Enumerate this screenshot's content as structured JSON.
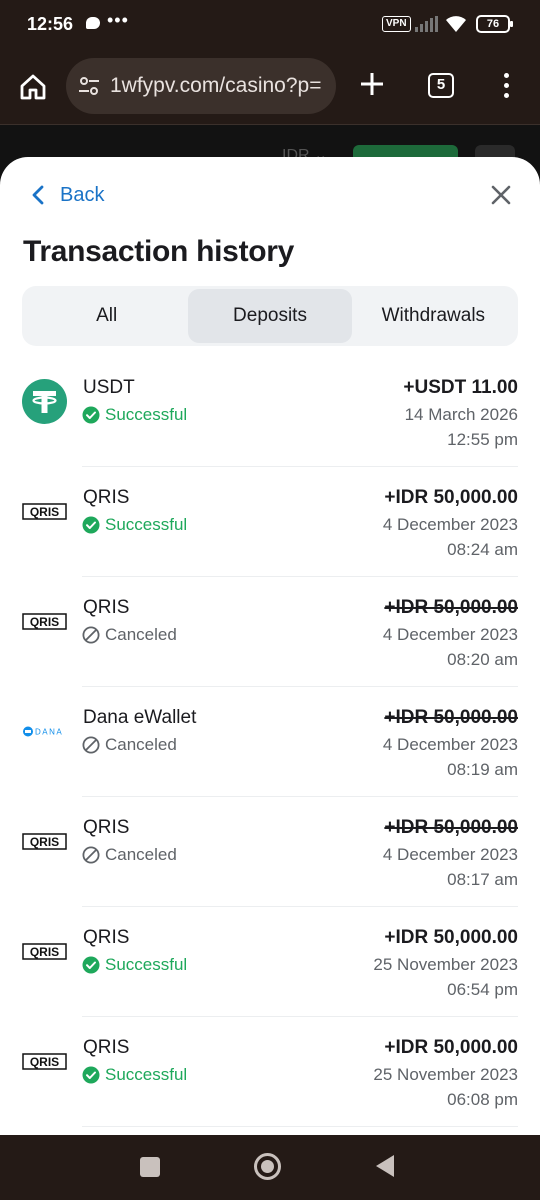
{
  "status_bar": {
    "time": "12:56",
    "dots": "•••",
    "vpn_label": "VPN",
    "battery": "76"
  },
  "browser": {
    "url": "1wfypv.com/casino?p=",
    "tab_count": "5"
  },
  "site_peek": {
    "currency": "IDR ⌄"
  },
  "sheet": {
    "back_label": "Back",
    "title": "Transaction history",
    "tabs": [
      {
        "label": "All",
        "active": false
      },
      {
        "label": "Deposits",
        "active": true
      },
      {
        "label": "Withdrawals",
        "active": false
      }
    ],
    "transactions": [
      {
        "method": "USDT",
        "logo": "tether-icon",
        "status": "Successful",
        "status_type": "ok",
        "amount": "+USDT 11.00",
        "struck": false,
        "date": "14 March 2026",
        "time": "12:55 pm"
      },
      {
        "method": "QRIS",
        "logo": "qris-icon",
        "status": "Successful",
        "status_type": "ok",
        "amount": "+IDR 50,000.00",
        "struck": false,
        "date": "4 December 2023",
        "time": "08:24 am"
      },
      {
        "method": "QRIS",
        "logo": "qris-icon",
        "status": "Canceled",
        "status_type": "cancel",
        "amount": "+IDR 50,000.00",
        "struck": true,
        "date": "4 December 2023",
        "time": "08:20 am"
      },
      {
        "method": "Dana eWallet",
        "logo": "dana-icon",
        "status": "Canceled",
        "status_type": "cancel",
        "amount": "+IDR 50,000.00",
        "struck": true,
        "date": "4 December 2023",
        "time": "08:19 am"
      },
      {
        "method": "QRIS",
        "logo": "qris-icon",
        "status": "Canceled",
        "status_type": "cancel",
        "amount": "+IDR 50,000.00",
        "struck": true,
        "date": "4 December 2023",
        "time": "08:17 am"
      },
      {
        "method": "QRIS",
        "logo": "qris-icon",
        "status": "Successful",
        "status_type": "ok",
        "amount": "+IDR 50,000.00",
        "struck": false,
        "date": "25 November 2023",
        "time": "06:54 pm"
      },
      {
        "method": "QRIS",
        "logo": "qris-icon",
        "status": "Successful",
        "status_type": "ok",
        "amount": "+IDR 50,000.00",
        "struck": false,
        "date": "25 November 2023",
        "time": "06:08 pm"
      }
    ]
  },
  "colors": {
    "accent": "#1a73c7",
    "success": "#1ea85b",
    "tether": "#26a17b",
    "dana": "#118eea"
  }
}
